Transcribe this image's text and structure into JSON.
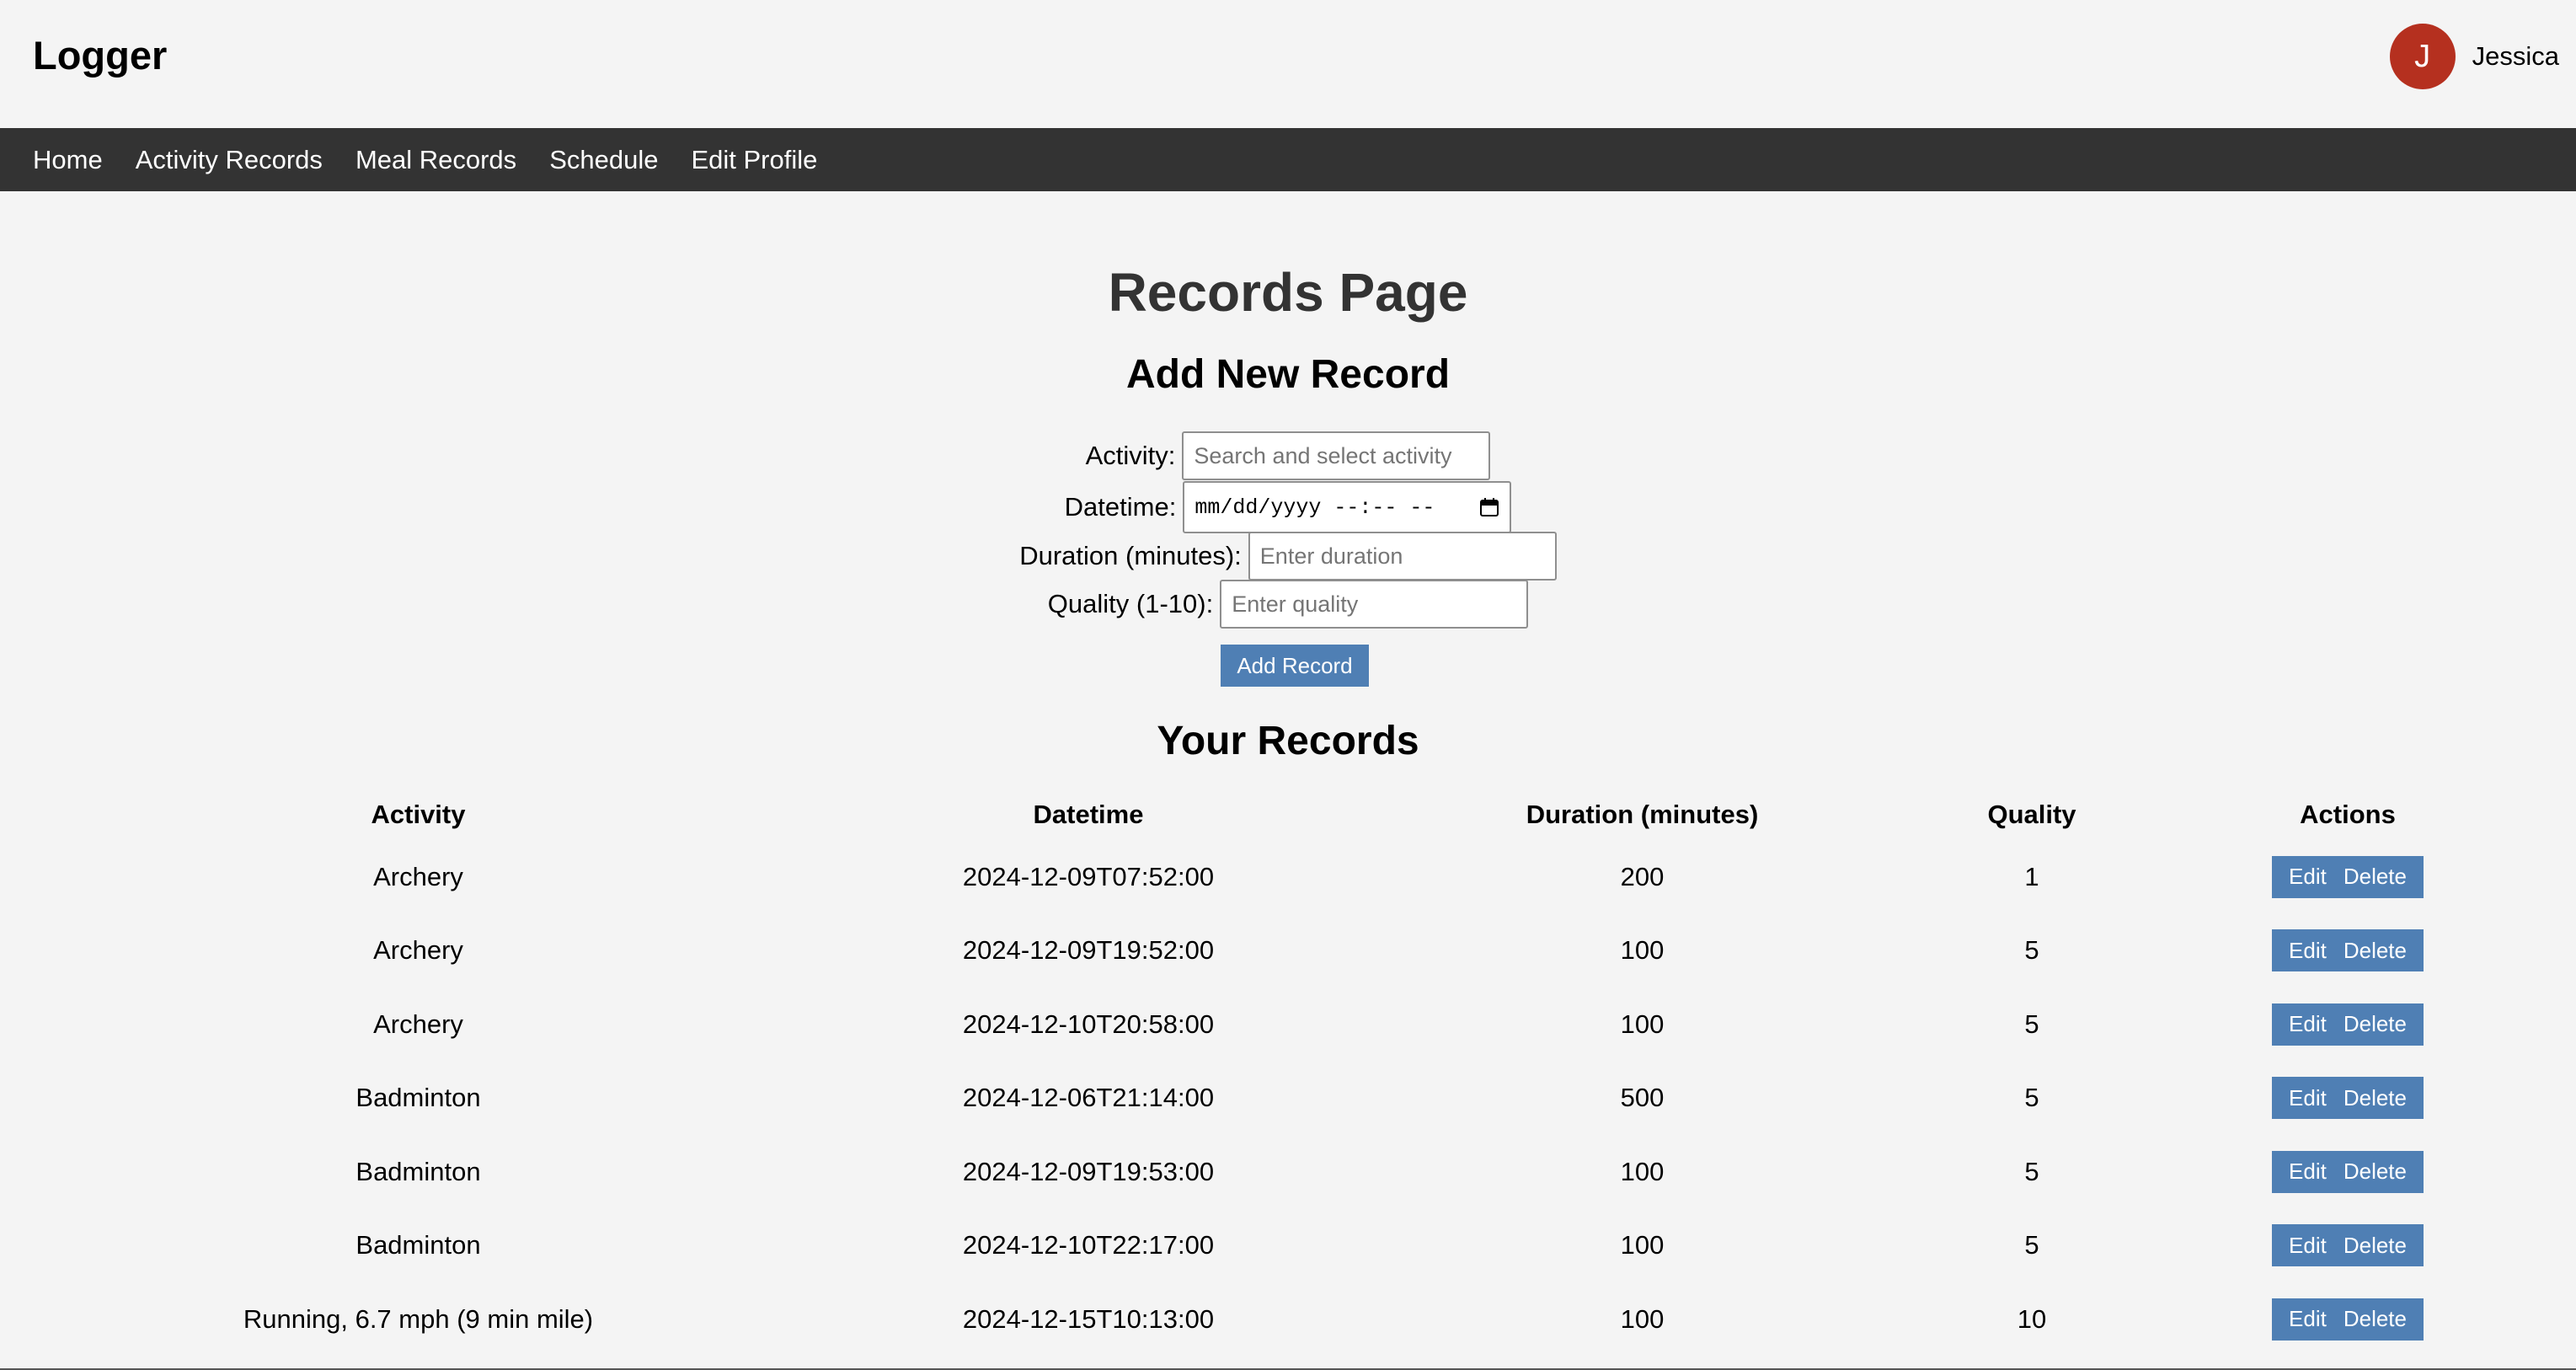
{
  "header": {
    "logo": "Logger",
    "user": {
      "initial": "J",
      "name": "Jessica",
      "avatar_color": "#b5301f"
    }
  },
  "nav": {
    "items": [
      "Home",
      "Activity Records",
      "Meal Records",
      "Schedule",
      "Edit Profile"
    ]
  },
  "page": {
    "title": "Records Page",
    "add_title": "Add New Record",
    "records_title": "Your Records"
  },
  "form": {
    "activity_label": "Activity:",
    "activity_placeholder": "Search and select activity",
    "datetime_label": "Datetime:",
    "datetime_placeholder": "mm/dd/yyyy --:-- --",
    "duration_label": "Duration (minutes):",
    "duration_placeholder": "Enter duration",
    "quality_label": "Quality (1-10):",
    "quality_placeholder": "Enter quality",
    "submit_label": "Add Record"
  },
  "table": {
    "headers": [
      "Activity",
      "Datetime",
      "Duration (minutes)",
      "Quality",
      "Actions"
    ],
    "edit_label": "Edit",
    "delete_label": "Delete",
    "rows": [
      {
        "activity": "Archery",
        "datetime": "2024-12-09T07:52:00",
        "duration": "200",
        "quality": "1"
      },
      {
        "activity": "Archery",
        "datetime": "2024-12-09T19:52:00",
        "duration": "100",
        "quality": "5"
      },
      {
        "activity": "Archery",
        "datetime": "2024-12-10T20:58:00",
        "duration": "100",
        "quality": "5"
      },
      {
        "activity": "Badminton",
        "datetime": "2024-12-06T21:14:00",
        "duration": "500",
        "quality": "5"
      },
      {
        "activity": "Badminton",
        "datetime": "2024-12-09T19:53:00",
        "duration": "100",
        "quality": "5"
      },
      {
        "activity": "Badminton",
        "datetime": "2024-12-10T22:17:00",
        "duration": "100",
        "quality": "5"
      },
      {
        "activity": "Running, 6.7 mph (9 min mile)",
        "datetime": "2024-12-15T10:13:00",
        "duration": "100",
        "quality": "10"
      }
    ]
  },
  "colors": {
    "background": "#f4f4f4",
    "navbar": "#333333",
    "button": "#4f7fb4"
  }
}
